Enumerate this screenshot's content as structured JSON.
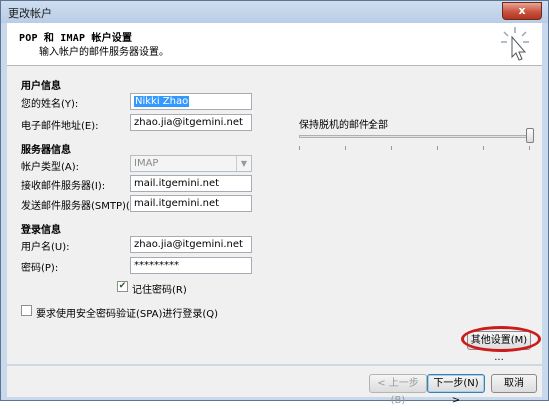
{
  "window": {
    "title": "更改帐户",
    "close_label": "x"
  },
  "header": {
    "title": "POP 和 IMAP 帐户设置",
    "subtitle": "输入帐户的邮件服务器设置。",
    "icon": "cursor-click-icon"
  },
  "user_info": {
    "heading": "用户信息",
    "name_label": "您的姓名(Y):",
    "name_value": "Nikki Zhao",
    "email_label": "电子邮件地址(E):",
    "email_value": "zhao.jia@itgemini.net"
  },
  "server_info": {
    "heading": "服务器信息",
    "account_type_label": "帐户类型(A):",
    "account_type_value": "IMAP",
    "incoming_label": "接收邮件服务器(I):",
    "incoming_value": "mail.itgemini.net",
    "outgoing_label": "发送邮件服务器(SMTP)(O):",
    "outgoing_value": "mail.itgemini.net"
  },
  "login_info": {
    "heading": "登录信息",
    "username_label": "用户名(U):",
    "username_value": "zhao.jia@itgemini.net",
    "password_label": "密码(P):",
    "password_value": "*********",
    "remember_label": "记住密码(R)",
    "remember_checked": true,
    "spa_label": "要求使用安全密码验证(SPA)进行登录(Q)",
    "spa_checked": false
  },
  "offline": {
    "label": "保持脱机的邮件：",
    "value": "全部"
  },
  "buttons": {
    "more_settings": "其他设置(M) ...",
    "back": "< 上一步(B)",
    "next": "下一步(N) >",
    "cancel": "取消"
  },
  "colors": {
    "highlight": "#cc1b1b",
    "selection": "#3399ff"
  }
}
